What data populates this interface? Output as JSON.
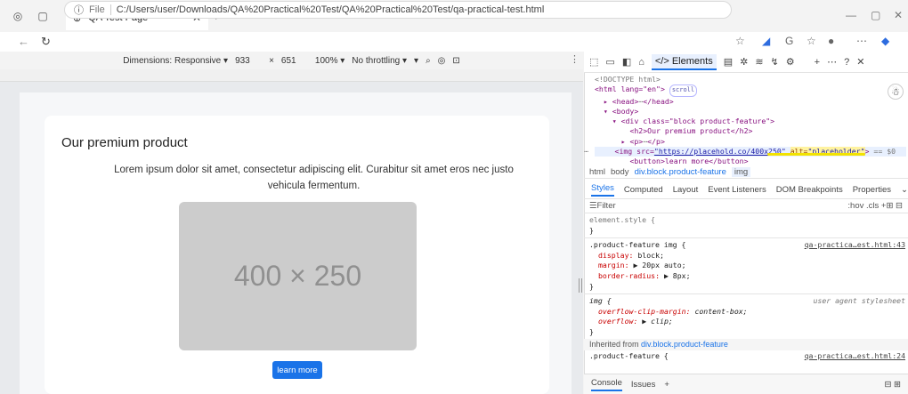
{
  "browser": {
    "tab_title": "QA Test Page",
    "url_label": "File",
    "url": "C:/Users/user/Downloads/QA%20Practical%20Test/QA%20Practical%20Test/qa-practical-test.html"
  },
  "device_toolbar": {
    "dimensions_label": "Dimensions: Responsive",
    "width": "933",
    "times": "×",
    "height": "651",
    "zoom": "100%",
    "throttling": "No throttling"
  },
  "page": {
    "heading": "Our premium product",
    "paragraph": "Lorem ipsum dolor sit amet, consectetur adipiscing elit. Curabitur sit amet eros nec justo vehicula fermentum.",
    "placeholder_text": "400 × 250",
    "button_label": "learn more"
  },
  "devtools": {
    "top_tabs": {
      "elements": "Elements"
    },
    "dom": {
      "doctype": "<!DOCTYPE html>",
      "html_open": "<html lang=\"en\">",
      "scroll_chip": "scroll",
      "head": "<head>",
      "head_dots": "⋯",
      "head_close": "</head>",
      "body": "<body>",
      "div_open": "<div class=\"block product-feature\">",
      "h2": "<h2>Our premium product</h2>",
      "p_open": "<p>",
      "p_dots": "⋯",
      "p_close": "</p>",
      "img_tag": "<img src=",
      "img_src": "\"https://placehold.co/400x250\"",
      "img_alt_name": "alt=",
      "img_alt_value": "\"placeholder\"",
      "img_close": ">",
      "img_tail": "== $0",
      "row_dots": "⋯",
      "button": "<button>learn more</button>"
    },
    "breadcrumbs": [
      "html",
      "body",
      "div.block.product-feature",
      "img"
    ],
    "pane_tabs": [
      "Styles",
      "Computed",
      "Layout",
      "Event Listeners",
      "DOM Breakpoints",
      "Properties"
    ],
    "filter_placeholder": "Filter",
    "filter_tools": ":hov  .cls  +",
    "styles": {
      "element_style": "element.style {",
      "close": "}",
      "rule1_selector": ".product-feature img {",
      "rule1_source": "qa-practica…est.html:43",
      "rule1_props": [
        {
          "name": "display",
          "value": "block;"
        },
        {
          "name": "margin",
          "value": "▶ 20px auto;"
        },
        {
          "name": "border-radius",
          "value": "▶ 8px;"
        }
      ],
      "rule2_selector": "img {",
      "rule2_source": "user agent stylesheet",
      "rule2_props": [
        {
          "name": "overflow-clip-margin",
          "value": "content-box;"
        },
        {
          "name": "overflow",
          "value": "▶ clip;"
        }
      ],
      "inherited_label": "Inherited from",
      "inherited_link": "div.block.product-feature",
      "rule3_selector": ".product-feature {",
      "rule3_source": "qa-practica…est.html:24"
    },
    "console_tabs": [
      "Console",
      "Issues"
    ]
  }
}
